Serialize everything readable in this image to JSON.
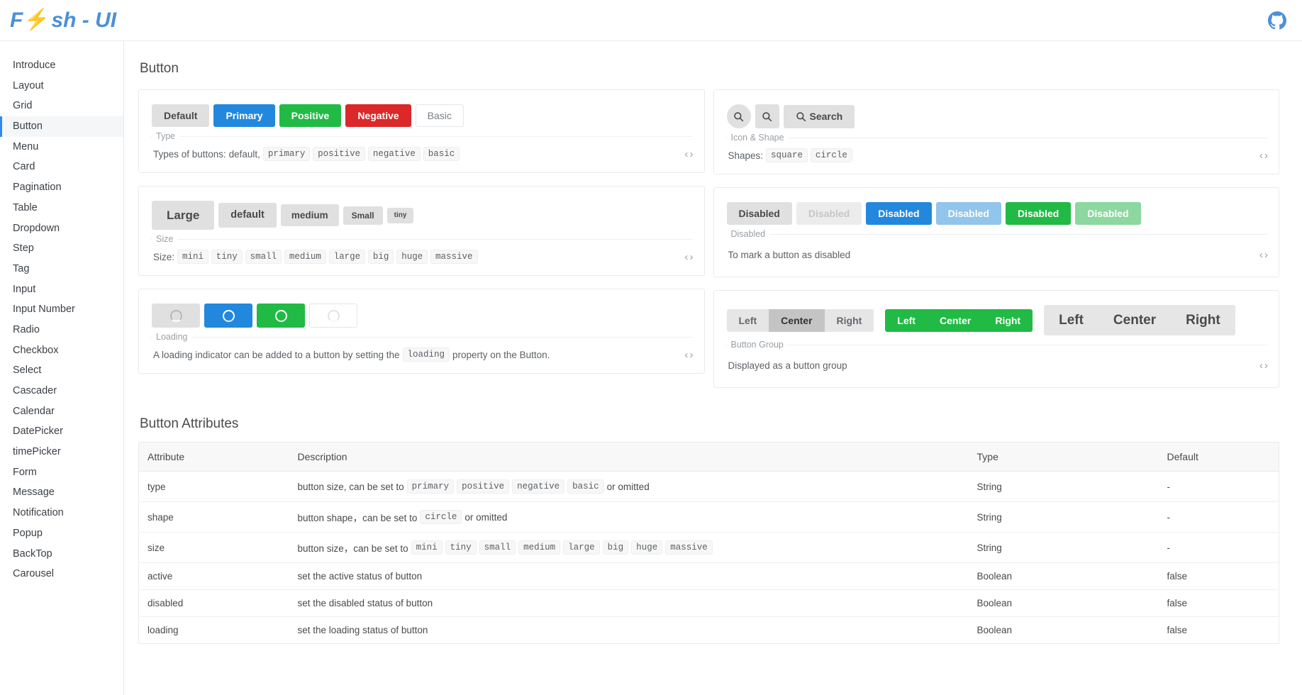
{
  "header": {
    "logo_text_before": "F",
    "logo_bolt": "⚡",
    "logo_text_after": "sh - UI",
    "github_icon": "github-icon",
    "accent_color": "#4a90d9"
  },
  "sidebar": {
    "items": [
      {
        "label": "Introduce",
        "active": false
      },
      {
        "label": "Layout",
        "active": false
      },
      {
        "label": "Grid",
        "active": false
      },
      {
        "label": "Button",
        "active": true
      },
      {
        "label": "Menu",
        "active": false
      },
      {
        "label": "Card",
        "active": false
      },
      {
        "label": "Pagination",
        "active": false
      },
      {
        "label": "Table",
        "active": false
      },
      {
        "label": "Dropdown",
        "active": false
      },
      {
        "label": "Step",
        "active": false
      },
      {
        "label": "Tag",
        "active": false
      },
      {
        "label": "Input",
        "active": false
      },
      {
        "label": "Input Number",
        "active": false
      },
      {
        "label": "Radio",
        "active": false
      },
      {
        "label": "Checkbox",
        "active": false
      },
      {
        "label": "Select",
        "active": false
      },
      {
        "label": "Cascader",
        "active": false
      },
      {
        "label": "Calendar",
        "active": false
      },
      {
        "label": "DatePicker",
        "active": false
      },
      {
        "label": "timePicker",
        "active": false
      },
      {
        "label": "Form",
        "active": false
      },
      {
        "label": "Message",
        "active": false
      },
      {
        "label": "Notification",
        "active": false
      },
      {
        "label": "Popup",
        "active": false
      },
      {
        "label": "BackTop",
        "active": false
      },
      {
        "label": "Carousel",
        "active": false
      }
    ]
  },
  "main": {
    "page_title": "Button",
    "code_toggle": "‹ ›",
    "cards": {
      "type": {
        "legend": "Type",
        "desc_prefix": "Types of buttons: default,",
        "chips": [
          "primary",
          "positive",
          "negative",
          "basic"
        ],
        "buttons": [
          {
            "label": "Default",
            "variant": "default"
          },
          {
            "label": "Primary",
            "variant": "primary"
          },
          {
            "label": "Positive",
            "variant": "positive"
          },
          {
            "label": "Negative",
            "variant": "negative"
          },
          {
            "label": "Basic",
            "variant": "basic"
          }
        ]
      },
      "icon_shape": {
        "legend": "Icon & Shape",
        "desc_prefix": "Shapes:",
        "chips": [
          "square",
          "circle"
        ],
        "buttons": [
          {
            "label": "",
            "shape": "circle",
            "icon": "search-icon"
          },
          {
            "label": "",
            "shape": "square",
            "icon": "search-icon"
          },
          {
            "label": "Search",
            "shape": "square",
            "icon": "search-icon"
          }
        ]
      },
      "size": {
        "legend": "Size",
        "desc_prefix": "Size:",
        "chips": [
          "mini",
          "tiny",
          "small",
          "medium",
          "large",
          "big",
          "huge",
          "massive"
        ],
        "buttons": [
          {
            "label": "Large",
            "size": "sz-large"
          },
          {
            "label": "default",
            "size": "sz-default"
          },
          {
            "label": "medium",
            "size": "sz-medium"
          },
          {
            "label": "Small",
            "size": "sz-small"
          },
          {
            "label": "tiny",
            "size": "sz-tiny"
          }
        ]
      },
      "disabled": {
        "legend": "Disabled",
        "desc_prefix": "To mark a button as disabled",
        "chips": [],
        "buttons": [
          {
            "label": "Disabled",
            "variant": "default"
          },
          {
            "label": "Disabled",
            "variant": "dim"
          },
          {
            "label": "Disabled",
            "variant": "primary"
          },
          {
            "label": "Disabled",
            "variant": "primary-dim"
          },
          {
            "label": "Disabled",
            "variant": "positive"
          },
          {
            "label": "Disabled",
            "variant": "positive-dim"
          }
        ]
      },
      "loading": {
        "legend": "Loading",
        "desc_prefix": "A loading indicator can be added to a button by setting the",
        "desc_chip": "loading",
        "desc_suffix": "property on the Button.",
        "buttons": [
          {
            "label": "",
            "variant": "default-load",
            "icon": "spinner-icon"
          },
          {
            "label": "",
            "variant": "primary",
            "icon": "spinner-icon"
          },
          {
            "label": "",
            "variant": "positive",
            "icon": "spinner-icon"
          },
          {
            "label": "",
            "variant": "basic-load",
            "icon": "spinner-icon"
          }
        ]
      },
      "button_group": {
        "legend": "Button Group",
        "desc_prefix": "Displayed as a button group",
        "chips": [],
        "groups": [
          {
            "style": "default",
            "items": [
              {
                "label": "Left",
                "active": false
              },
              {
                "label": "Center",
                "active": true
              },
              {
                "label": "Right",
                "active": false
              }
            ]
          },
          {
            "style": "green",
            "items": [
              {
                "label": "Left",
                "active": false
              },
              {
                "label": "Center",
                "active": false
              },
              {
                "label": "Right",
                "active": false
              }
            ]
          },
          {
            "style": "large",
            "items": [
              {
                "label": "Left",
                "active": false
              },
              {
                "label": "Center",
                "active": false
              },
              {
                "label": "Right",
                "active": false
              }
            ]
          }
        ]
      }
    },
    "attributes_table": {
      "title": "Button Attributes",
      "headers": [
        "Attribute",
        "Description",
        "Type",
        "Default"
      ],
      "rows": [
        {
          "attribute": "type",
          "desc_prefix": "button size, can be set to",
          "chips": [
            "primary",
            "positive",
            "negative",
            "basic"
          ],
          "desc_suffix": "or omitted",
          "type": "String",
          "default": "-"
        },
        {
          "attribute": "shape",
          "desc_prefix": "button shape，can be set to",
          "chips": [
            "circle"
          ],
          "desc_suffix": "or omitted",
          "type": "String",
          "default": "-"
        },
        {
          "attribute": "size",
          "desc_prefix": "button size，can be set to",
          "chips": [
            "mini",
            "tiny",
            "small",
            "medium",
            "large",
            "big",
            "huge",
            "massive"
          ],
          "desc_suffix": "",
          "type": "String",
          "default": "-"
        },
        {
          "attribute": "active",
          "desc_prefix": "set the active status of button",
          "chips": [],
          "desc_suffix": "",
          "type": "Boolean",
          "default": "false"
        },
        {
          "attribute": "disabled",
          "desc_prefix": "set the disabled status of button",
          "chips": [],
          "desc_suffix": "",
          "type": "Boolean",
          "default": "false"
        },
        {
          "attribute": "loading",
          "desc_prefix": "set the loading status of button",
          "chips": [],
          "desc_suffix": "",
          "type": "Boolean",
          "default": "false"
        }
      ]
    }
  }
}
